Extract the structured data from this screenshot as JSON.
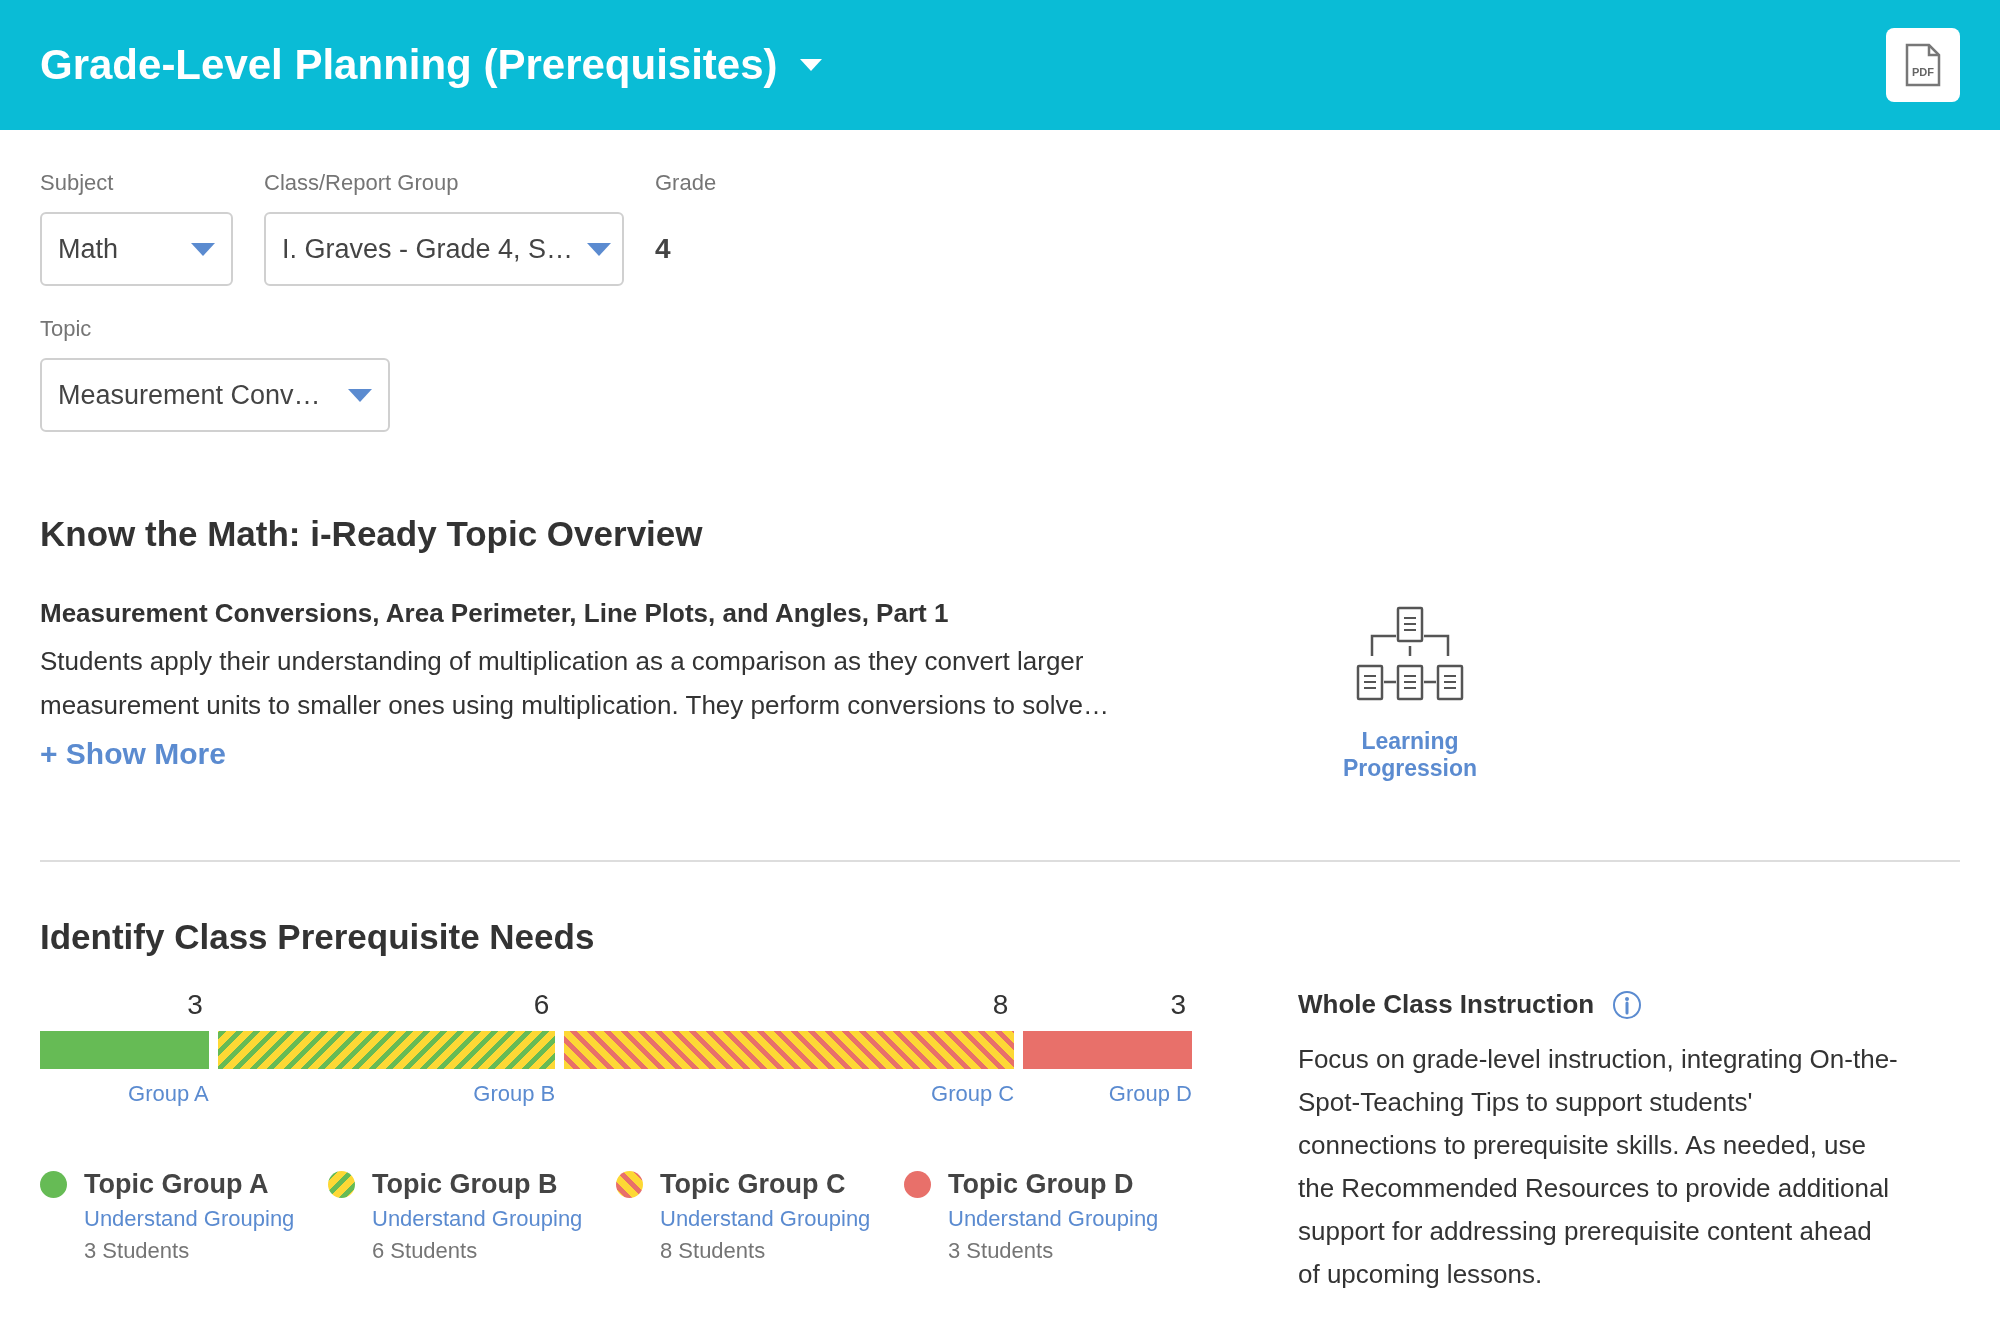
{
  "header": {
    "title": "Grade-Level Planning (Prerequisites)",
    "export_button": {
      "label": "PDF"
    }
  },
  "filters": [
    {
      "label": "Subject",
      "kind": "dropdown",
      "value": "Math"
    },
    {
      "label": "Class/Report Group",
      "kind": "dropdown",
      "value": "I. Graves - Grade 4, S…"
    },
    {
      "label": "Grade",
      "kind": "static",
      "value": "4"
    },
    {
      "label": "Topic",
      "kind": "dropdown",
      "value": "Measurement Conv…"
    }
  ],
  "overview": {
    "heading": "Know the Math: i-Ready Topic Overview",
    "topic_title": "Measurement Conversions, Area Perimeter, Line Plots, and Angles, Part 1",
    "description": "Students apply their understanding of multiplication as a comparison as they convert larger measurement units to smaller ones using multiplication. They perform conversions to solve…",
    "show_more": "+ Show More",
    "learning_progression": "Learning Progression"
  },
  "prerequisites": {
    "heading": "Identify Class Prerequisite Needs",
    "segments": [
      {
        "count": "3",
        "label": "Group A",
        "kind": "solid",
        "color": "#66bb55"
      },
      {
        "count": "6",
        "label": "Group B",
        "kind": "striped",
        "color": "#66bb55"
      },
      {
        "count": "8",
        "label": "Group C",
        "kind": "striped",
        "color": "#e8706a"
      },
      {
        "count": "3",
        "label": "Group D",
        "kind": "solid",
        "color": "#e8706a"
      }
    ],
    "legend": [
      {
        "name": "Topic Group A",
        "link": "Understand Grouping",
        "students": "3 Students",
        "kind": "solid",
        "color": "#66bb55"
      },
      {
        "name": "Topic Group B",
        "link": "Understand Grouping",
        "students": "6 Students",
        "kind": "striped",
        "color": "#66bb55"
      },
      {
        "name": "Topic Group C",
        "link": "Understand Grouping",
        "students": "8 Students",
        "kind": "striped",
        "color": "#e8706a"
      },
      {
        "name": "Topic Group D",
        "link": "Understand Grouping",
        "students": "3 Students",
        "kind": "solid",
        "color": "#e8706a"
      }
    ],
    "instruction": {
      "title": "Whole Class Instruction",
      "body": "Focus on grade-level instruction, integrating On-the-Spot-Teaching Tips to support students' connections to prerequisite skills. As needed, use the Recommended Resources to provide additional support for addressing prerequisite content ahead of upcoming lessons."
    }
  }
}
